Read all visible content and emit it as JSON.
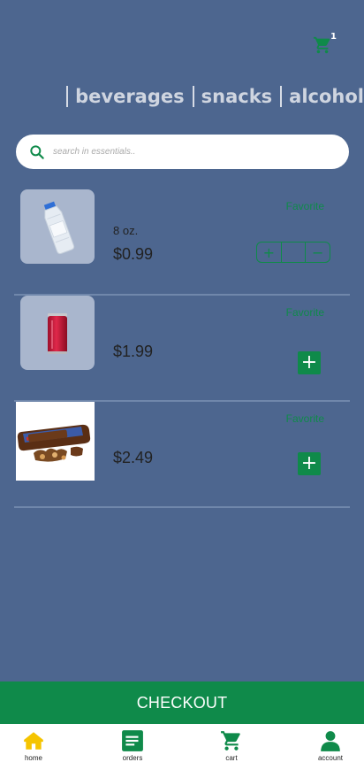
{
  "header": {
    "cart_badge": "1",
    "cart_icon": "cart-icon"
  },
  "categories": [
    {
      "label": "beverages"
    },
    {
      "label": "snacks"
    },
    {
      "label": "alcohol"
    }
  ],
  "search": {
    "placeholder": "search in essentials.."
  },
  "products": [
    {
      "image": "water-bottle",
      "qty": "8 oz.",
      "price": "$0.99",
      "favorite": "Favorite"
    },
    {
      "image": "red-soda-can",
      "qty": "",
      "price": "$1.99",
      "favorite": "Favorite"
    },
    {
      "image": "snickers-bar",
      "qty": "",
      "price": "$2.49",
      "favorite": "Favorite"
    }
  ],
  "stepper": {
    "plus": "+",
    "value": "",
    "minus": "−"
  },
  "add_symbol": "+",
  "checkout_label": "CHECKOUT",
  "tabs": [
    {
      "label": "home",
      "icon": "home-icon"
    },
    {
      "label": "orders",
      "icon": "orders-icon"
    },
    {
      "label": "cart",
      "icon": "cart-icon"
    },
    {
      "label": "account",
      "icon": "account-icon"
    }
  ],
  "colors": {
    "background": "#4d668f",
    "accent": "#0f8a4a",
    "home_tab": "#f5c400"
  }
}
